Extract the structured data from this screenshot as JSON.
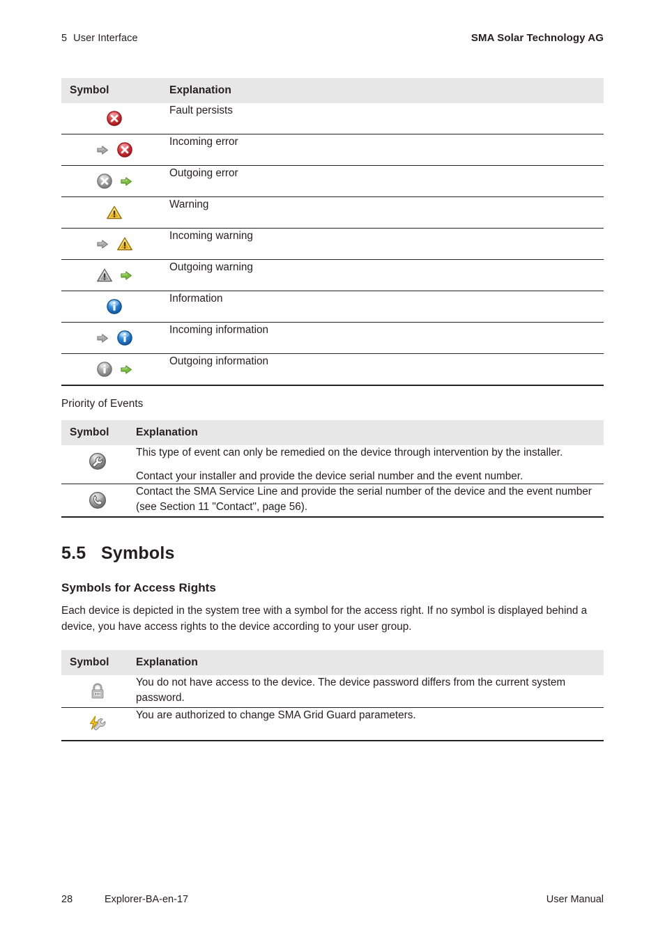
{
  "header": {
    "chapter_number": "5",
    "chapter_title": "User Interface",
    "company": "SMA Solar Technology AG"
  },
  "footer": {
    "page_number": "28",
    "document_id": "Explorer-BA-en-17",
    "document_type": "User Manual"
  },
  "event_status_table": {
    "columns": [
      "Symbol",
      "Explanation"
    ],
    "rows": [
      {
        "icons": [
          "error-red-icon"
        ],
        "explanation": "Fault persists"
      },
      {
        "icons": [
          "arrow-grey-icon",
          "error-red-icon"
        ],
        "explanation": "Incoming error"
      },
      {
        "icons": [
          "error-grey-icon",
          "arrow-green-icon"
        ],
        "explanation": "Outgoing error"
      },
      {
        "icons": [
          "warning-yellow-icon"
        ],
        "explanation": "Warning"
      },
      {
        "icons": [
          "arrow-grey-icon",
          "warning-yellow-icon"
        ],
        "explanation": "Incoming warning"
      },
      {
        "icons": [
          "warning-grey-icon",
          "arrow-green-icon"
        ],
        "explanation": "Outgoing warning"
      },
      {
        "icons": [
          "information-blue-icon"
        ],
        "explanation": "Information"
      },
      {
        "icons": [
          "arrow-grey-icon",
          "information-blue-icon"
        ],
        "explanation": "Incoming information"
      },
      {
        "icons": [
          "information-grey-icon",
          "arrow-green-icon"
        ],
        "explanation": "Outgoing information"
      }
    ]
  },
  "priority_label": "Priority of Events",
  "priority_table": {
    "columns": [
      "Symbol",
      "Explanation"
    ],
    "rows": [
      {
        "icon": "wrench-circle-icon",
        "paragraphs": [
          "This type of event can only be remedied on the device through intervention by the installer.",
          "Contact your installer and provide the device serial number and the event number."
        ]
      },
      {
        "icon": "phone-circle-icon",
        "paragraphs": [
          "Contact the SMA Service Line and provide the serial number of the device and the event number (see Section 11 \"Contact\", page 56)."
        ]
      }
    ]
  },
  "section": {
    "number": "5.5",
    "title": "Symbols"
  },
  "subsection": {
    "title": "Symbols for Access Rights",
    "paragraph": "Each device is depicted in the system tree with a symbol for the access right. If no symbol is displayed behind a device, you have access rights to the device according to your user group."
  },
  "access_rights_table": {
    "columns": [
      "Symbol",
      "Explanation"
    ],
    "rows": [
      {
        "icon": "padlock-icon",
        "explanation": "You do not have access to the device. The device password differs from the current system password."
      },
      {
        "icon": "grid-guard-icon",
        "explanation": "You are authorized to change SMA Grid Guard parameters."
      }
    ]
  },
  "colors": {
    "table_header_bg": "#e7e7e7",
    "rule": "#231f20",
    "error_red": "#c8202a",
    "warning_yellow": "#f2b705",
    "info_blue": "#1f7fd4",
    "arrow_green": "#5ca62e",
    "arrow_grey": "#8c8c8c",
    "icon_grey": "#9a9a9a"
  }
}
